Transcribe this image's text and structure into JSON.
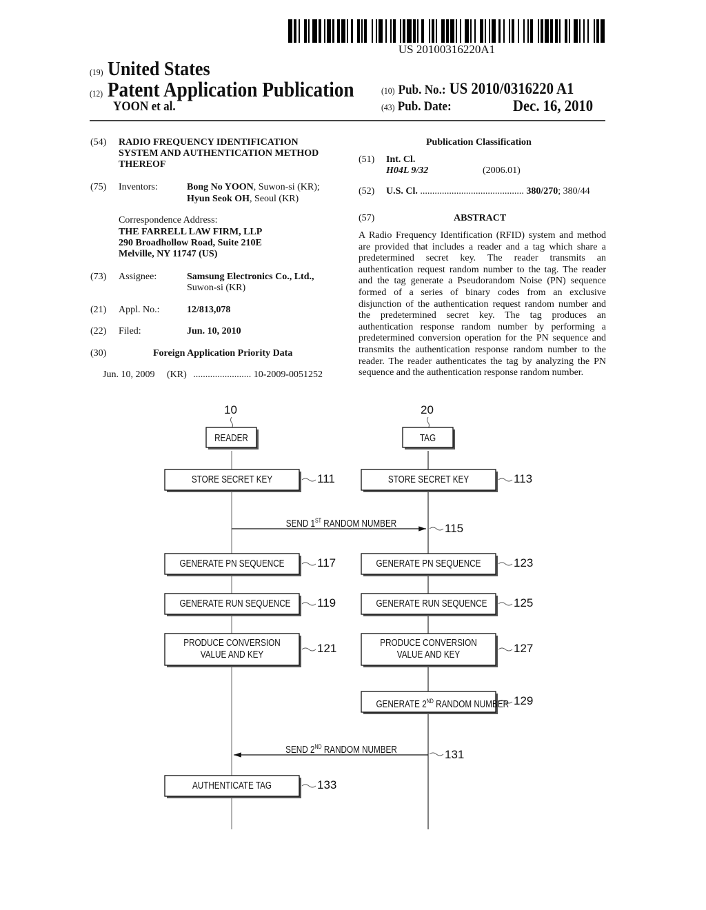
{
  "barcode": {
    "text": "US 20100316220A1"
  },
  "header": {
    "country_code": "(19)",
    "country": "United States",
    "type_code": "(12)",
    "type": "Patent Application Publication",
    "authors": "YOON et al.",
    "pub_no_code": "(10)",
    "pub_no_label": "Pub. No.:",
    "pub_no": "US 2010/0316220 A1",
    "pub_date_code": "(43)",
    "pub_date_label": "Pub. Date:",
    "pub_date": "Dec. 16, 2010"
  },
  "biblio": {
    "title_code": "(54)",
    "title_lines": [
      "RADIO FREQUENCY IDENTIFICATION",
      "SYSTEM AND AUTHENTICATION METHOD",
      "THEREOF"
    ],
    "inventors_code": "(75)",
    "inventors_label": "Inventors:",
    "inventor1_name": "Bong No YOON",
    "inventor1_loc": ", Suwon-si (KR);",
    "inventor2_name": "Hyun Seok OH",
    "inventor2_loc": ", Seoul (KR)",
    "correspondence_label": "Correspondence Address:",
    "correspondence_lines": [
      "THE FARRELL LAW FIRM, LLP",
      "290 Broadhollow Road, Suite 210E",
      "Melville, NY 11747 (US)"
    ],
    "assignee_code": "(73)",
    "assignee_label": "Assignee:",
    "assignee_name": "Samsung Electronics Co., Ltd.,",
    "assignee_loc": "Suwon-si (KR)",
    "appl_code": "(21)",
    "appl_label": "Appl. No.:",
    "appl_no": "12/813,078",
    "filed_code": "(22)",
    "filed_label": "Filed:",
    "filed_date": "Jun. 10, 2010",
    "foreign_code": "(30)",
    "foreign_title": "Foreign Application Priority Data",
    "foreign_date": "Jun. 10, 2009",
    "foreign_country": "(KR)",
    "foreign_dots": "........................",
    "foreign_no": "10-2009-0051252"
  },
  "classification": {
    "title": "Publication Classification",
    "int_code": "(51)",
    "int_label": "Int. Cl.",
    "int_class": "H04L 9/32",
    "int_version": "(2006.01)",
    "us_code": "(52)",
    "us_label": "U.S. Cl.",
    "us_dots": "...........................................",
    "us_primary": "380/270",
    "us_secondary": "; 380/44"
  },
  "abstract": {
    "code": "(57)",
    "title": "ABSTRACT",
    "text": "A Radio Frequency Identification (RFID) system and method are provided that includes a reader and a tag which share a predetermined secret key. The reader transmits an authentication request random number to the tag. The reader and the tag generate a Pseudorandom Noise (PN) sequence formed of a series of binary codes from an exclusive disjunction of the authentication request random number and the predetermined secret key. The tag produces an authentication response random number by performing a predetermined conversion operation for the PN sequence and transmits the authentication response random number to the reader. The reader authenticates the tag by analyzing the PN sequence and the authentication response random number."
  },
  "diagram": {
    "reader": {
      "ref": "10",
      "label": "READER"
    },
    "tag": {
      "ref": "20",
      "label": "TAG"
    },
    "reader_steps": [
      {
        "label": "STORE SECRET KEY",
        "ref": "111"
      },
      {
        "label": "GENERATE PN SEQUENCE",
        "ref": "117"
      },
      {
        "label": "GENERATE RUN SEQUENCE",
        "ref": "119"
      },
      {
        "label_line1": "PRODUCE CONVERSION",
        "label_line2": "VALUE AND KEY",
        "ref": "121"
      },
      {
        "label": "AUTHENTICATE TAG",
        "ref": "133"
      }
    ],
    "tag_steps": [
      {
        "label": "STORE SECRET KEY",
        "ref": "113"
      },
      {
        "label": "GENERATE PN SEQUENCE",
        "ref": "123"
      },
      {
        "label": "GENERATE RUN SEQUENCE",
        "ref": "125"
      },
      {
        "label_line1": "PRODUCE CONVERSION",
        "label_line2": "VALUE AND KEY",
        "ref": "127"
      },
      {
        "label_pre": "GENERATE 2",
        "label_sup": "ND",
        "label_post": " RANDOM NUMBER",
        "ref": "129"
      }
    ],
    "messages": [
      {
        "pre": "SEND 1",
        "sup": "ST",
        "post": " RANDOM NUMBER",
        "ref": "115",
        "direction": "reader-to-tag"
      },
      {
        "pre": "SEND 2",
        "sup": "ND",
        "post": " RANDOM NUMBER",
        "ref": "131",
        "direction": "tag-to-reader"
      }
    ]
  }
}
